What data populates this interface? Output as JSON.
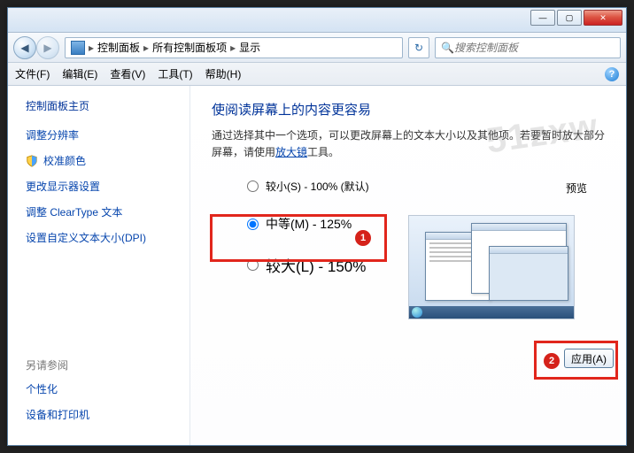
{
  "titlebar": {
    "min": "—",
    "max": "▢",
    "close": "✕"
  },
  "breadcrumb": {
    "root": "控制面板",
    "level1": "所有控制面板项",
    "level2": "显示",
    "sep": "▸"
  },
  "search": {
    "placeholder": "搜索控制面板",
    "icon": "🔍"
  },
  "menubar": {
    "file": "文件(F)",
    "edit": "编辑(E)",
    "view": "查看(V)",
    "tools": "工具(T)",
    "help": "帮助(H)",
    "help_icon": "?"
  },
  "sidebar": {
    "home": "控制面板主页",
    "links": [
      "调整分辨率",
      "校准颜色",
      "更改显示器设置",
      "调整 ClearType 文本",
      "设置自定义文本大小(DPI)"
    ],
    "see_also_heading": "另请参阅",
    "see_also": [
      "个性化",
      "设备和打印机"
    ]
  },
  "main": {
    "heading": "使阅读屏幕上的内容更容易",
    "desc_prefix": "通过选择其中一个选项，可以更改屏幕上的文本大小以及其他项。若要暂时放大部分屏幕，请使用",
    "desc_link": "放大镜",
    "desc_suffix": "工具。",
    "preview_label": "预览",
    "options": {
      "small": "较小(S) - 100% (默认)",
      "medium": "中等(M) - 125%",
      "large": "较大(L) - 150%"
    },
    "apply": "应用(A)"
  },
  "annotations": {
    "badge1": "1",
    "badge2": "2"
  },
  "watermark": "51zxw"
}
